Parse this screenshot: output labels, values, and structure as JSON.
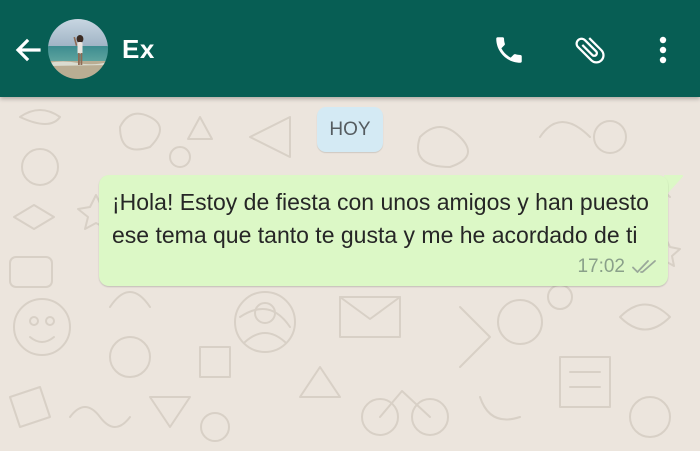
{
  "header": {
    "contact_name": "Ex",
    "background_color": "#075e54",
    "icons": {
      "back": "arrow-back-icon",
      "call": "phone-icon",
      "attach": "paperclip-icon",
      "menu": "more-vert-icon"
    }
  },
  "chat": {
    "background_color": "#ece5dd",
    "date_chip": "HOY",
    "messages": [
      {
        "direction": "outgoing",
        "text": "¡Hola! Estoy de fiesta con unos amigos y han puesto ese tema que tanto te gusta y me he acordado de ti",
        "time": "17:02",
        "status": "delivered-double-check-icon",
        "bubble_color": "#dcf8c6"
      }
    ]
  }
}
